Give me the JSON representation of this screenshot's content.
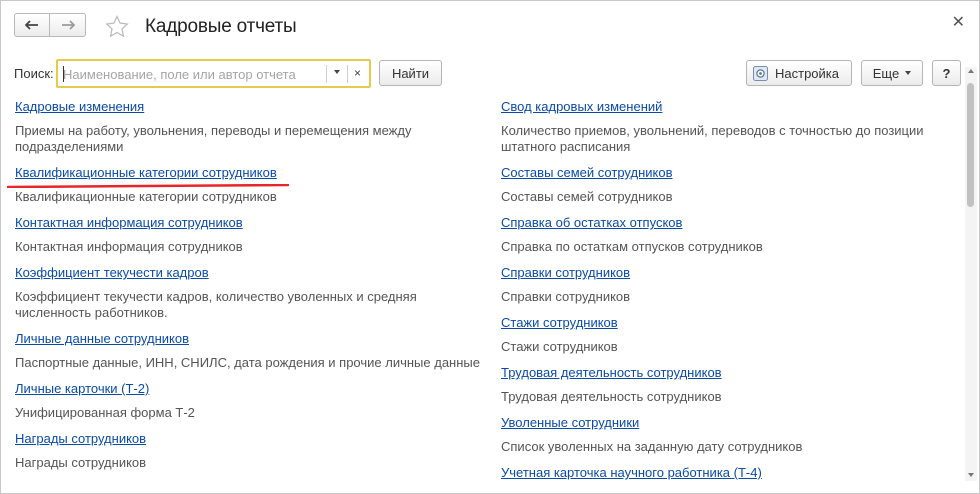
{
  "window": {
    "title": "Кадровые отчеты"
  },
  "search": {
    "label": "Поиск:",
    "placeholder": "Наименование, поле или автор отчета",
    "clear": "×",
    "find_label": "Найти"
  },
  "toolbar": {
    "settings_label": "Настройка",
    "more_label": "Еще",
    "help_label": "?"
  },
  "icons": {
    "back": "arrow-left-icon",
    "forward": "arrow-right-icon",
    "favorite": "star-icon",
    "close": "close-icon",
    "settings": "settings-panel-icon"
  },
  "colors": {
    "link": "#0a4ba8",
    "search_border": "#e9c94c",
    "annotation": "#e8262a"
  },
  "reports_left": [
    {
      "name": "Кадровые изменения",
      "description": "Приемы на работу, увольнения, переводы и перемещения между подразделениями"
    },
    {
      "name": "Квалификационные категории сотрудников",
      "description": "Квалификационные категории сотрудников"
    },
    {
      "name": "Контактная информация сотрудников",
      "description": "Контактная информация сотрудников"
    },
    {
      "name": "Коэффициент текучести кадров",
      "description": "Коэффициент текучести кадров, количество уволенных и средняя численность работников."
    },
    {
      "name": "Личные данные сотрудников",
      "description": "Паспортные данные, ИНН, СНИЛС, дата рождения и прочие личные данные"
    },
    {
      "name": "Личные карточки (Т-2)",
      "description": "Унифицированная форма Т-2"
    },
    {
      "name": "Награды сотрудников",
      "description": "Награды сотрудников"
    }
  ],
  "reports_right": [
    {
      "name": "Свод кадровых изменений",
      "description": "Количество приемов, увольнений, переводов с точностью до позиции штатного расписания"
    },
    {
      "name": "Составы семей сотрудников",
      "description": "Составы семей сотрудников"
    },
    {
      "name": "Справка об остатках отпусков",
      "description": "Справка по остаткам отпусков сотрудников"
    },
    {
      "name": "Справки сотрудников",
      "description": "Справки сотрудников"
    },
    {
      "name": "Стажи сотрудников",
      "description": "Стажи сотрудников"
    },
    {
      "name": "Трудовая деятельность сотрудников",
      "description": "Трудовая деятельность сотрудников"
    },
    {
      "name": "Уволенные сотрудники",
      "description": "Список уволенных на заданную дату сотрудников"
    },
    {
      "name": "Учетная карточка научного работника (Т-4)",
      "description": ""
    }
  ]
}
